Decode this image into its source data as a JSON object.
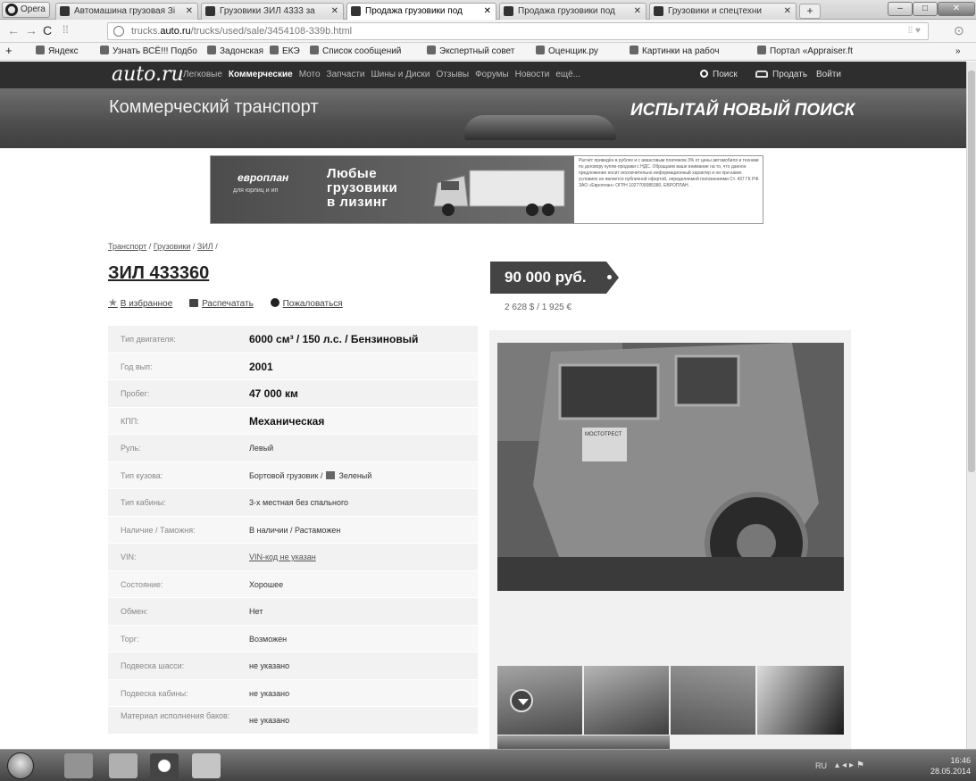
{
  "browser": {
    "opera_label": "Opera",
    "tabs": [
      {
        "label": "Автомашина грузовая Зі"
      },
      {
        "label": "Грузовики ЗИЛ 4333 за"
      },
      {
        "label": "Продажа грузовики под"
      },
      {
        "label": "Продажа грузовики под"
      },
      {
        "label": "Грузовики и спецтехни"
      }
    ],
    "url_prefix": "trucks.",
    "url_domain": "auto.ru",
    "url_path": "/trucks/used/sale/3454108-339b.html",
    "bookmarks": [
      {
        "label": "Яндекс"
      },
      {
        "label": "Узнать ВСЁ!!! Подбо"
      },
      {
        "label": "Задонская"
      },
      {
        "label": "ЕКЭ"
      },
      {
        "label": "Список сообщений"
      },
      {
        "label": "Экспертный совет"
      },
      {
        "label": "Оценщик.ру"
      },
      {
        "label": "Картинки на рабоч"
      },
      {
        "label": "Портал «Appraiser.ft"
      }
    ]
  },
  "site": {
    "logo": "auto.ru",
    "nav": [
      "Легковые",
      "Коммерческие",
      "Мото",
      "Запчасти",
      "Шины и Диски",
      "Отзывы",
      "Форумы",
      "Новости",
      "ещё..."
    ],
    "search_label": "Поиск",
    "sell_label": "Продать",
    "login_label": "Войти",
    "banner_title": "Коммерческий транспорт",
    "banner_slogan": "ИСПЫТАЙ НОВЫЙ ПОИСК"
  },
  "ad": {
    "logo": "европлан",
    "sub": "для юрлиц и ип",
    "headline_1": "Любые",
    "headline_2": "грузовики",
    "headline_3": "в лизинг",
    "fineprint": "Расчёт приведён в рублях и с авансовым платежом 3% от цены автомобиля и техники по договору купли-продажи с НДС. Обращаем ваше внимание на то, что данное предложение носит исключительно информационный характер и ни при каких условиях не является публичной офертой, определяемой положениями Ст. 437 ГК РФ. ЗАО «Европлан» ОГРН 1027700085380, ЕВРОПЛАН."
  },
  "listing": {
    "breadcrumbs": [
      "Транспорт",
      "Грузовики",
      "ЗИЛ"
    ],
    "title": "ЗИЛ 433360",
    "actions": {
      "favorite": "В избранное",
      "print": "Распечатать",
      "complain": "Пожаловаться"
    },
    "price": "90 000 руб.",
    "price_converted": "2 628 $ / 1 925 €",
    "specs": [
      {
        "label": "Тип двигателя:",
        "value": "6000 см³ / 150 л.с. / Бензиновый"
      },
      {
        "label": "Год вып:",
        "value": "2001"
      },
      {
        "label": "Пробег:",
        "value": "47 000 км"
      },
      {
        "label": "КПП:",
        "value": "Механическая"
      },
      {
        "label": "Руль:",
        "value": "Левый"
      },
      {
        "label": "Тип кузова:",
        "value": "Бортовой грузовик /",
        "value2": "Зеленый"
      },
      {
        "label": "Тип кабины:",
        "value": "3-х местная без спального"
      },
      {
        "label": "Наличие / Таможня:",
        "value": "В наличии / Растаможен"
      },
      {
        "label": "VIN:",
        "value": "VIN-код не указан"
      },
      {
        "label": "Состояние:",
        "value": "Хорошее"
      },
      {
        "label": "Обмен:",
        "value": "Нет"
      },
      {
        "label": "Торг:",
        "value": "Возможен"
      },
      {
        "label": "Подвеска шасси:",
        "value": "не указано"
      },
      {
        "label": "Подвеска кабины:",
        "value": "не указано"
      },
      {
        "label": "Материал исполнения баков:",
        "value": "не указано"
      }
    ],
    "photo_caption": "МОСТОТРЕСТ"
  },
  "taskbar": {
    "lang": "RU",
    "time": "16:46",
    "date": "28.05.2014"
  }
}
